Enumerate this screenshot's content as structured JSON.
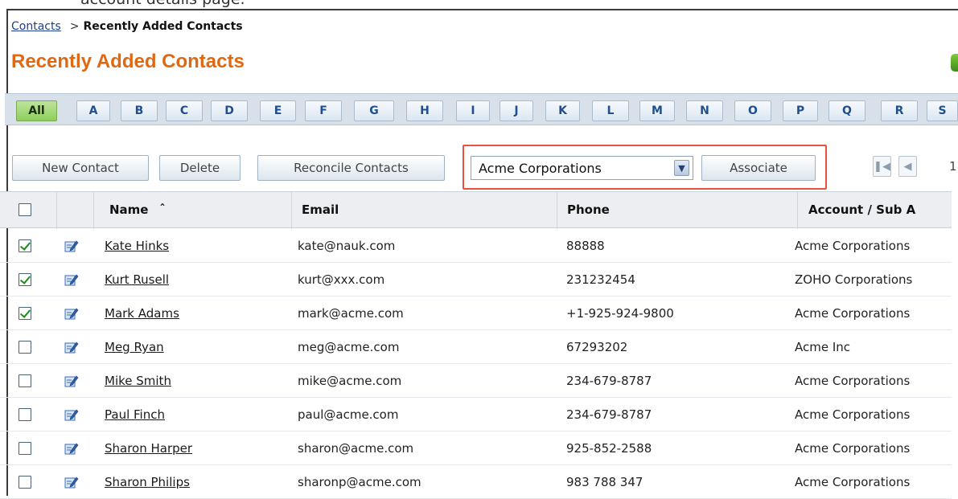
{
  "caption": "account details page.",
  "breadcrumb": {
    "parent": "Contacts",
    "separator": ">",
    "current": "Recently Added Contacts"
  },
  "page_title": "Recently Added Contacts",
  "alphabet": [
    "All",
    "A",
    "B",
    "C",
    "D",
    "E",
    "F",
    "G",
    "H",
    "I",
    "J",
    "K",
    "L",
    "M",
    "N",
    "O",
    "P",
    "Q",
    "R",
    "S"
  ],
  "toolbar": {
    "new_contact": "New Contact",
    "delete": "Delete",
    "reconcile": "Reconcile Contacts",
    "account_select": "Acme Corporations",
    "associate": "Associate",
    "page_number": "1"
  },
  "table": {
    "headers": {
      "name": "Name",
      "sort_glyph": "ˆ",
      "email": "Email",
      "phone": "Phone",
      "account": "Account / Sub A"
    },
    "rows": [
      {
        "checked": true,
        "name": "Kate Hinks",
        "email": "kate@nauk.com",
        "phone": "88888",
        "account": "Acme Corporations"
      },
      {
        "checked": true,
        "name": "Kurt Rusell",
        "email": "kurt@xxx.com",
        "phone": "231232454",
        "account": "ZOHO Corporations"
      },
      {
        "checked": true,
        "name": "Mark Adams",
        "email": "mark@acme.com",
        "phone": "+1-925-924-9800",
        "account": "Acme Corporations"
      },
      {
        "checked": false,
        "name": "Meg Ryan",
        "email": "meg@acme.com",
        "phone": "67293202",
        "account": "Acme Inc"
      },
      {
        "checked": false,
        "name": "Mike Smith",
        "email": "mike@acme.com",
        "phone": "234-679-8787",
        "account": "Acme Corporations"
      },
      {
        "checked": false,
        "name": "Paul Finch",
        "email": "paul@acme.com",
        "phone": "234-679-8787",
        "account": "Acme Corporations"
      },
      {
        "checked": false,
        "name": "Sharon Harper",
        "email": "sharon@acme.com",
        "phone": "925-852-2588",
        "account": "Acme Corporations"
      },
      {
        "checked": false,
        "name": "Sharon Philips",
        "email": "sharonp@acme.com",
        "phone": "983 788 347",
        "account": "Acme Corporations"
      }
    ]
  },
  "colors": {
    "title": "#e06812",
    "highlight_box": "#e8513d",
    "active_letter": "#8ccf5a"
  },
  "icons": {
    "row_edit": "edit-pencil-icon",
    "sort": "sort-asc-icon",
    "pager_first": "first-page-icon",
    "pager_prev": "prev-page-icon",
    "select_arrow": "chevron-down-icon"
  }
}
